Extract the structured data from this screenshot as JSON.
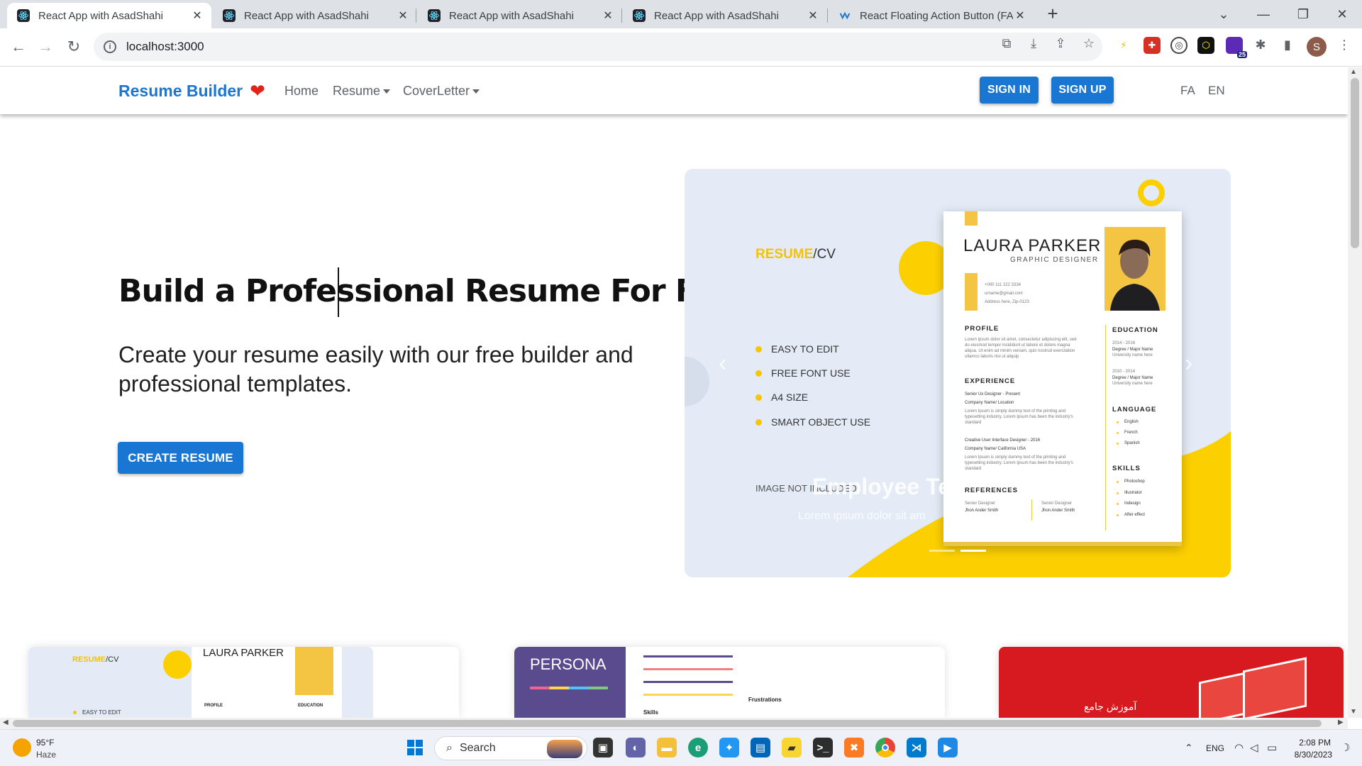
{
  "browser": {
    "tabs": [
      {
        "title": "React App with AsadShahi",
        "active": true,
        "icon": "react-icon"
      },
      {
        "title": "React App with AsadShahi",
        "active": false,
        "icon": "react-icon"
      },
      {
        "title": "React App with AsadShahi",
        "active": false,
        "icon": "react-icon"
      },
      {
        "title": "React App with AsadShahi",
        "active": false,
        "icon": "react-icon"
      },
      {
        "title": "React Floating Action Button (FAB",
        "active": false,
        "icon": "fab-icon"
      }
    ],
    "url": "localhost:3000",
    "profile_initial": "S",
    "extension_badge": "25"
  },
  "navbar": {
    "brand": "Resume Builder",
    "brand_icon": "heart-icon",
    "links": [
      {
        "label": "Home",
        "dropdown": false
      },
      {
        "label": "Resume",
        "dropdown": true
      },
      {
        "label": "CoverLetter",
        "dropdown": true
      }
    ],
    "sign_in": "SIGN IN",
    "sign_up": "SIGN UP",
    "languages": [
      "FA",
      "EN"
    ]
  },
  "hero": {
    "title": "Build a Professional Resume For Free",
    "subtitle": "Create your resume easily with our free builder and professional templates.",
    "cta": "CREATE RESUME"
  },
  "carousel": {
    "tag_accent": "RESUME",
    "tag_rest": "/CV",
    "features": [
      "EASY TO EDIT",
      "FREE FONT USE",
      "A4 SIZE",
      "SMART OBJECT USE"
    ],
    "image_note": "IMAGE NOT INCLUDED",
    "caption_title": "Employee Te",
    "caption_text": "Lorem ipsum dolor sit am",
    "active_slide": 2,
    "slides": 2,
    "resume": {
      "name": "LAURA PARKER",
      "role": "GRAPHIC DESIGNER",
      "contact": [
        "+000 111 222 3334",
        "urname@gmail.com",
        "Address here, Zip-0123"
      ],
      "sections": {
        "profile": "PROFILE",
        "experience": "EXPERIENCE",
        "references": "REFERENCES",
        "education": "EDUCATION",
        "language": "LANGUAGE",
        "skills": "SKILLS"
      },
      "profile_text": "Lorem ipsum dolor sit amet, consectetur adipiscing elit, sed do eiusmod tempor incididunt ut labore et dolore magna aliqua. Ut enim ad minim veniam, quis nostrud exercitation ullamco laboris nisi ut aliquip",
      "jobs": [
        {
          "title": "Senior Ux Designer - Present",
          "company": "Company Name/ Location",
          "text": "Lorem Ipsum is simply dummy text of the printing and typesetting industry. Lorem Ipsum has been the industry's standard"
        },
        {
          "title": "Creative User Interface Designer - 2016",
          "company": "Company Name/ California USA",
          "text": "Lorem Ipsum is simply dummy text of the printing and typesetting industry. Lorem Ipsum has been the industry's standard"
        }
      ],
      "education": [
        {
          "years": "2014 - 2016",
          "degree": "Degree / Major Name",
          "school": "University name here"
        },
        {
          "years": "2010 - 2014",
          "degree": "Degree / Major Name",
          "school": "University name here"
        }
      ],
      "languages": [
        "English",
        "French",
        "Spanish"
      ],
      "skills": [
        "Photoshop",
        "Illustrator",
        "Indesign",
        "After effect"
      ],
      "refs": [
        {
          "role": "Senior Designer",
          "name": "Jhon Ander Smith"
        },
        {
          "role": "Senior Designer",
          "name": "Jhon Ander Smith"
        }
      ]
    }
  },
  "cards": [
    {
      "tag_accent": "RESUME",
      "tag_rest": "/CV",
      "name": "LAURA PARKER",
      "feature": "EASY TO EDIT",
      "sections": [
        "PROFILE",
        "EDUCATION"
      ]
    },
    {
      "heading": "PERSONA",
      "skills": "Skills",
      "frustrations": "Frustrations"
    },
    {
      "text": "آموزش جامع"
    }
  ],
  "taskbar": {
    "weather_temp": "95°F",
    "weather_desc": "Haze",
    "search": "Search",
    "lang": "ENG",
    "time": "2:08 PM",
    "date": "8/30/2023"
  },
  "colors": {
    "primary": "#1976d2",
    "accent_yellow": "#fcd000",
    "carousel_bg": "#e4ebf6",
    "heart": "#e2231a"
  }
}
